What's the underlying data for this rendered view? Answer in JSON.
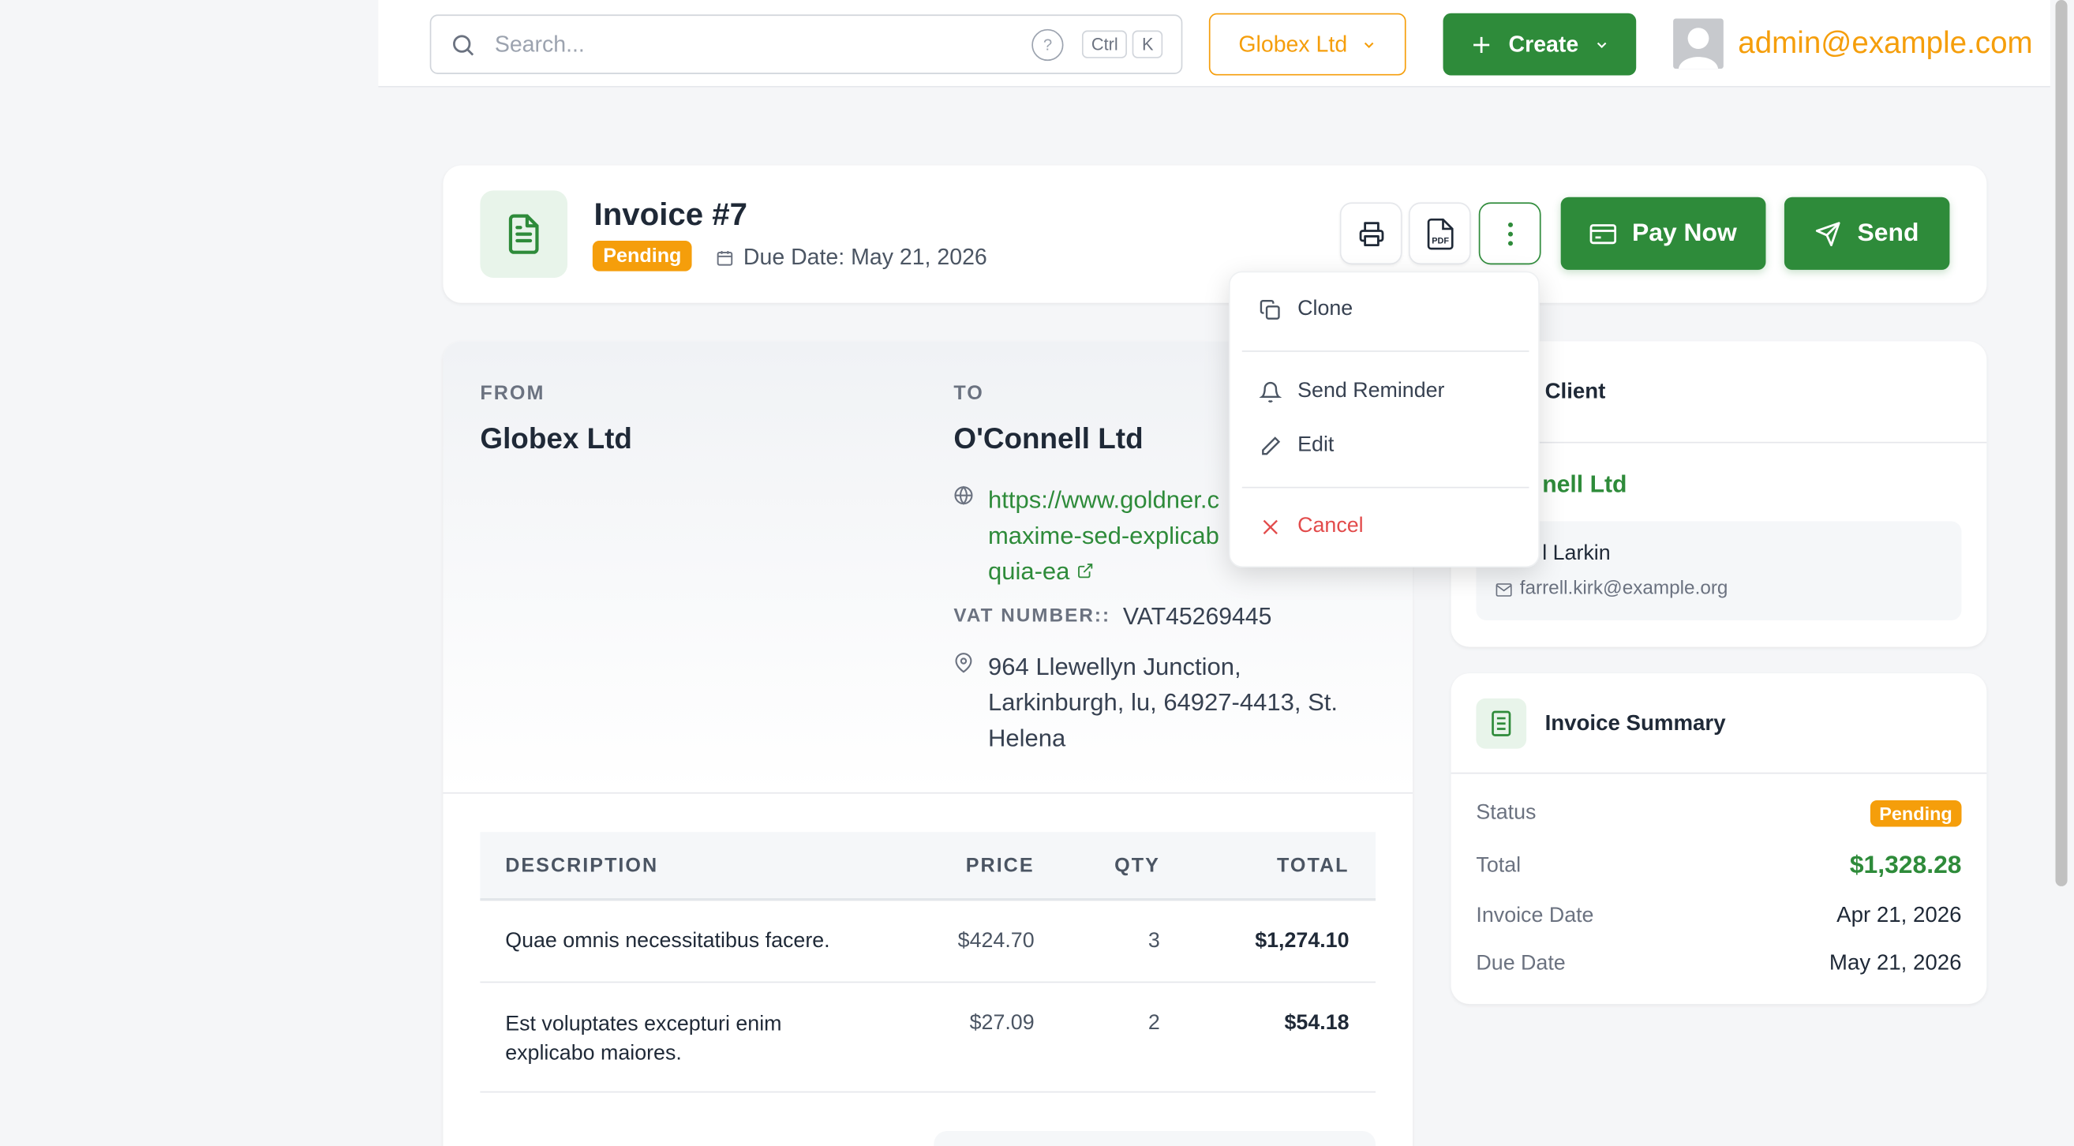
{
  "topbar": {
    "search": {
      "placeholder": "Search...",
      "help": "?",
      "kbd_ctrl": "Ctrl",
      "kbd_k": "K"
    },
    "org_label": "Globex Ltd",
    "create_label": "Create",
    "user_email": "admin@example.com"
  },
  "invoice": {
    "title": "Invoice #7",
    "status": "Pending",
    "due_text": "Due Date: May 21, 2026",
    "actions": {
      "pay_now": "Pay Now",
      "send": "Send"
    }
  },
  "menu": {
    "items": [
      {
        "label": "Clone"
      },
      {
        "label": "Send Reminder"
      },
      {
        "label": "Edit"
      },
      {
        "label": "Cancel"
      }
    ]
  },
  "from": {
    "label": "FROM",
    "name": "Globex Ltd"
  },
  "to": {
    "label": "TO",
    "name": "O'Connell Ltd",
    "website_lines": [
      "https://www.goldner.c",
      "maxime-sed-explicab",
      "quia-ea"
    ],
    "vat_label": "VAT NUMBER::",
    "vat_value": "VAT45269445",
    "address_lines": [
      "964 Llewellyn Junction,",
      "Larkinburgh, lu, 64927-4413, St.",
      "Helena"
    ]
  },
  "table": {
    "headers": {
      "description": "DESCRIPTION",
      "price": "PRICE",
      "qty": "QTY",
      "total": "TOTAL"
    },
    "rows": [
      {
        "description": [
          "Quae omnis necessitatibus facere."
        ],
        "price": "$424.70",
        "qty": "3",
        "total": "$1,274.10"
      },
      {
        "description": [
          "Est voluptates excepturi enim",
          "explicabo maiores."
        ],
        "price": "$27.09",
        "qty": "2",
        "total": "$54.18"
      }
    ]
  },
  "client": {
    "title": "Client",
    "company": "nell Ltd",
    "contact_name": "l Larkin",
    "contact_email": "farrell.kirk@example.org"
  },
  "summary": {
    "title": "Invoice Summary",
    "status_label": "Status",
    "status_value": "Pending",
    "total_label": "Total",
    "total_value": "$1,328.28",
    "invoice_date_label": "Invoice Date",
    "invoice_date_value": "Apr 21, 2026",
    "due_date_label": "Due Date",
    "due_date_value": "May 21, 2026"
  },
  "colors": {
    "brand_green": "#2e8b3a",
    "accent_amber": "#f59e0b",
    "danger_red": "#e24b4b"
  }
}
